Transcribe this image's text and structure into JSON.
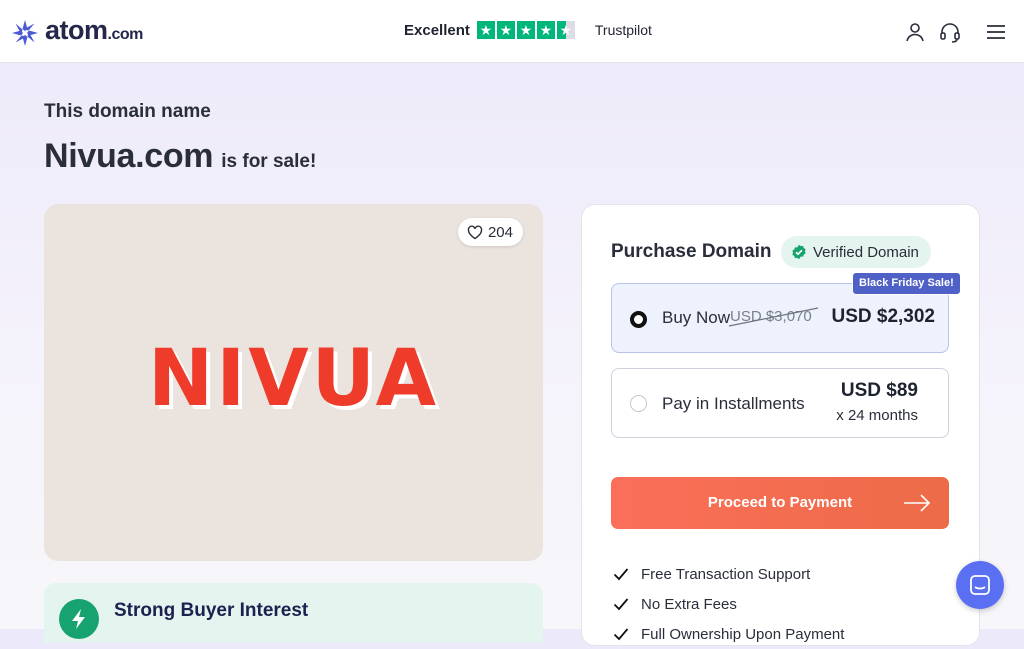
{
  "header": {
    "logo_text": "atom",
    "logo_tld": ".com",
    "trustpilot_label": "Excellent",
    "trustpilot_brand": "Trustpilot",
    "trustpilot_stars": 4.5
  },
  "page": {
    "subhead": "This domain name",
    "domain": "Nivua.com",
    "for_sale": "is for sale!"
  },
  "logo_card": {
    "likes": "204",
    "brand_mark": "NIVUA",
    "brand_color": "#ef3b2a"
  },
  "interest": {
    "title": "Strong Buyer Interest"
  },
  "purchase": {
    "title": "Purchase Domain",
    "verified_label": "Verified Domain",
    "sale_badge": "Black Friday Sale!",
    "buy_now": {
      "label": "Buy Now",
      "old_price": "USD $3,070",
      "price": "USD $2,302"
    },
    "installments": {
      "label": "Pay in Installments",
      "price": "USD $89",
      "term": "x 24 months"
    },
    "cta_label": "Proceed to Payment",
    "features": [
      "Free Transaction Support",
      "No Extra Fees",
      "Full Ownership Upon Payment"
    ]
  },
  "colors": {
    "accent": "#ef6d4e",
    "badge": "#4f60c7",
    "verified": "#16a36f"
  }
}
